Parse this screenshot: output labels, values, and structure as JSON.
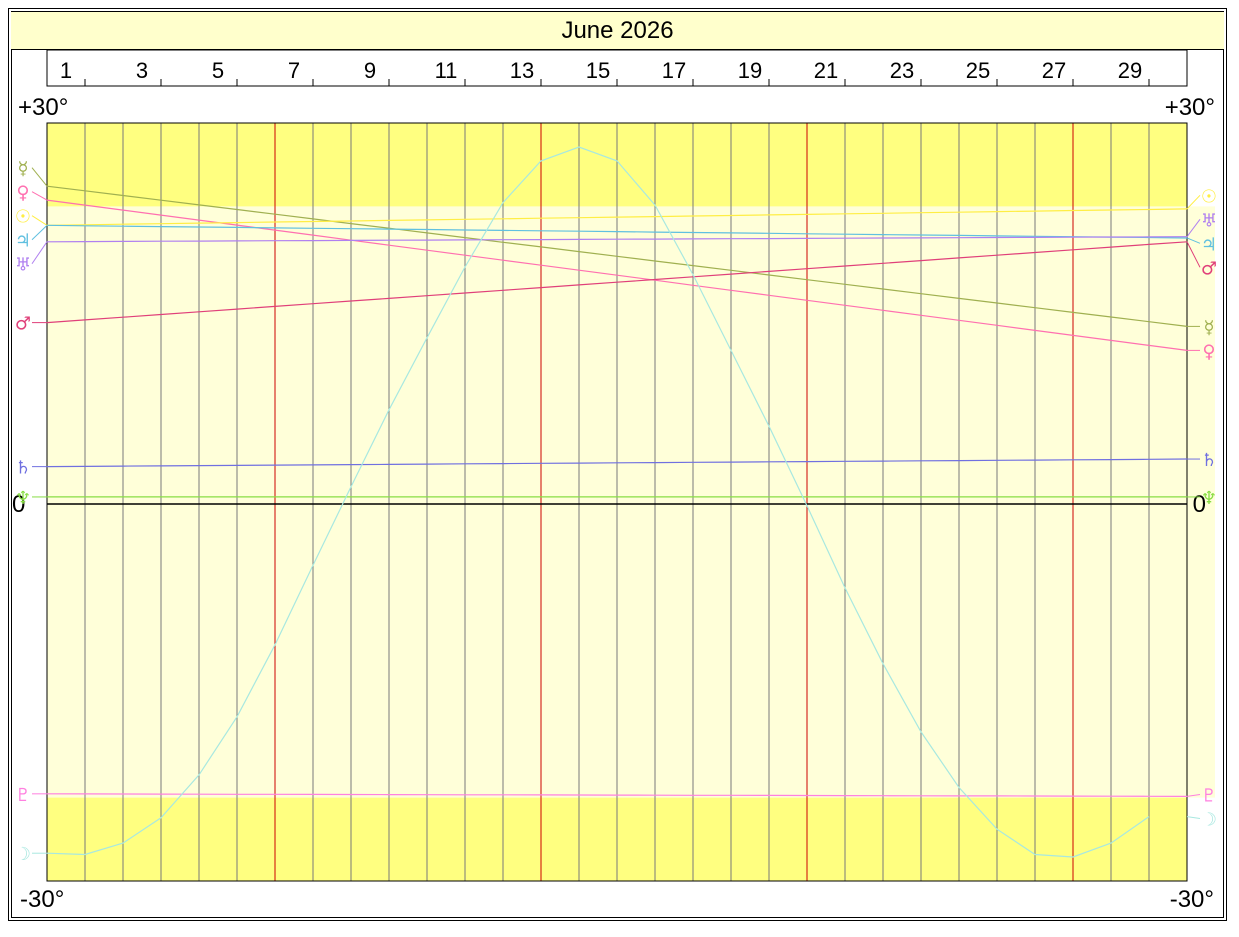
{
  "title": "June 2026",
  "chart_data": {
    "type": "line",
    "title": "June 2026",
    "x_ticks": [
      "1",
      "3",
      "5",
      "7",
      "9",
      "11",
      "13",
      "15",
      "17",
      "19",
      "21",
      "23",
      "25",
      "27",
      "29"
    ],
    "days": [
      1,
      2,
      3,
      4,
      5,
      6,
      7,
      8,
      9,
      10,
      11,
      12,
      13,
      14,
      15,
      16,
      17,
      18,
      19,
      20,
      21,
      22,
      23,
      24,
      25,
      26,
      27,
      28,
      29,
      30,
      31
    ],
    "week_lines": [
      7,
      14,
      21,
      28
    ],
    "ylim": [
      -30,
      30
    ],
    "y_labels": {
      "top": "+30°",
      "zero": "0",
      "bottom": "-30°"
    },
    "ecliptic_band": [
      -23.4,
      23.4
    ],
    "colors": {
      "background_outer": "#ffff80",
      "background_inner": "#ffffd9",
      "gridline": "#7a7a7a",
      "weekline": "#cc0000",
      "zero_line": "#000000"
    },
    "series": [
      {
        "symbol": "☿",
        "color": "#a0b050",
        "start": 25.0,
        "end": 13.9
      },
      {
        "symbol": "♀",
        "color": "#ff70b0",
        "start": 23.9,
        "end": 12.0
      },
      {
        "symbol": "☉",
        "color": "#ffee44",
        "start": 21.9,
        "end": 23.2
      },
      {
        "symbol": "♃",
        "color": "#60c0e0",
        "start": 21.9,
        "end": 20.9
      },
      {
        "symbol": "♅",
        "color": "#b080f0",
        "start": 20.6,
        "end": 21.0
      },
      {
        "symbol": "♂",
        "color": "#e0407a",
        "start": 14.2,
        "end": 20.6
      },
      {
        "symbol": "♄",
        "color": "#7070e0",
        "start": 2.8,
        "end": 3.4
      },
      {
        "symbol": "♆",
        "color": "#88dd44",
        "start": 0.4,
        "end": 0.4
      },
      {
        "symbol": "♇",
        "color": "#ff80e0",
        "start": -23.1,
        "end": -23.3
      },
      {
        "symbol": "☽",
        "color": "#a8e8e0",
        "values": [
          -27.8,
          -27.9,
          -27.0,
          -25.0,
          -21.6,
          -17.0,
          -11.3,
          -5.0,
          1.2,
          7.3,
          13.0,
          18.6,
          23.7,
          27.0,
          28.1,
          27.0,
          23.5,
          18.0,
          12.0,
          6.0,
          -0.3,
          -6.8,
          -12.8,
          -18.2,
          -22.6,
          -25.9,
          -27.9,
          -28.1,
          -27.0,
          -24.9
        ]
      }
    ]
  }
}
